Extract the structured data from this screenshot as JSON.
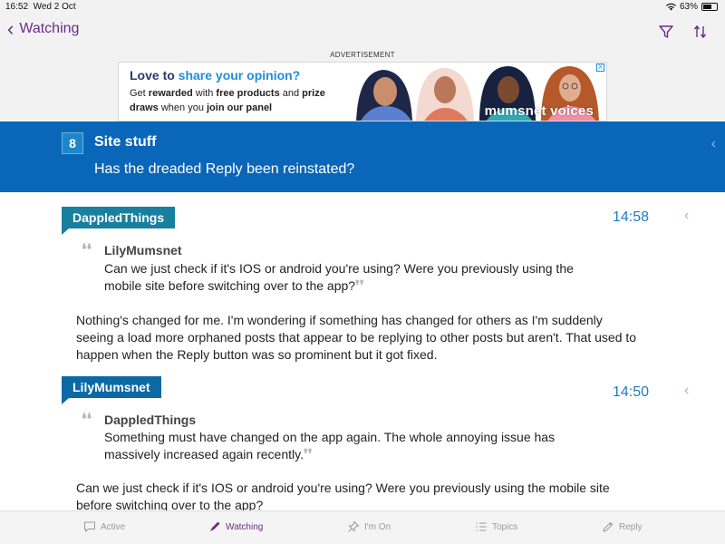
{
  "status_bar": {
    "time": "16:52",
    "date": "Wed 2 Oct",
    "battery": "63%",
    "battery_level": 0.63
  },
  "nav": {
    "back_label": "Watching",
    "filter_icon": "filter-icon",
    "sort_icon": "sort-icon"
  },
  "ad": {
    "label": "ADVERTISEMENT",
    "headline_start": "Love to ",
    "headline_highlight": "share your opinion?",
    "line1_start": "Get ",
    "line1_bold1": "rewarded",
    "line1_mid": " with ",
    "line1_bold2": "free products",
    "line1_mid2": " and ",
    "line1_bold3": "prize",
    "line2_bold": "draws",
    "line2_mid": " when you ",
    "line2_bold2": "join our panel",
    "brand": "mumsnet voices",
    "close": "X"
  },
  "thread": {
    "topic_number": "8",
    "category": "Site stuff",
    "title": "Has the dreaded Reply been reinstated?"
  },
  "posts": [
    {
      "author": "DappledThings",
      "time": "14:58",
      "quote_author": "LilyMumsnet",
      "quote_text": "Can we just check if it's IOS or android you're using? Were you previously using the mobile site before switching over to the app?",
      "body": "Nothing's changed for me. I'm wondering if something has changed for others as I'm suddenly seeing a load more orphaned posts that appear to be replying to other posts but aren't. That used to happen when the Reply button was so prominent but it got fixed."
    },
    {
      "author": "LilyMumsnet",
      "time": "14:50",
      "quote_author": "DappledThings",
      "quote_text": "Something must have changed on the app again. The whole annoying issue has massively increased again recently.",
      "body": "Can we just check if it's IOS or android you're using? Were you previously using the mobile site before switching over to the app?"
    }
  ],
  "tabs": [
    {
      "label": "Active",
      "icon": "speech-bubble-icon"
    },
    {
      "label": "Watching",
      "icon": "pen-icon"
    },
    {
      "label": "I'm On",
      "icon": "pin-icon"
    },
    {
      "label": "Topics",
      "icon": "list-icon"
    },
    {
      "label": "Reply",
      "icon": "pencil-icon"
    }
  ],
  "colors": {
    "accent": "#6b2d86",
    "header_blue": "#0a66b8",
    "author_teal": "#197f9f",
    "author_blue": "#0b69a6",
    "time_blue": "#1e7bc4"
  }
}
